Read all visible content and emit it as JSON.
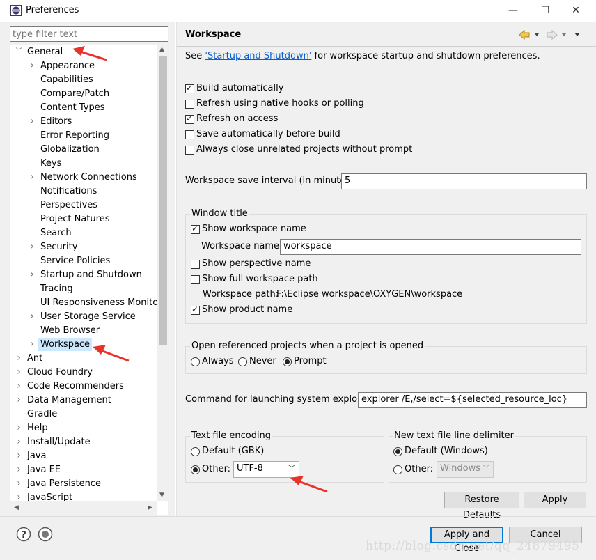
{
  "window": {
    "title": "Preferences",
    "minimize_glyph": "—",
    "maximize_glyph": "☐",
    "close_glyph": "✕"
  },
  "filter": {
    "placeholder": "type filter text"
  },
  "tree": {
    "general": "General",
    "general_children": [
      {
        "label": "Appearance",
        "expandable": true
      },
      {
        "label": "Capabilities",
        "expandable": false
      },
      {
        "label": "Compare/Patch",
        "expandable": false
      },
      {
        "label": "Content Types",
        "expandable": false
      },
      {
        "label": "Editors",
        "expandable": true
      },
      {
        "label": "Error Reporting",
        "expandable": false
      },
      {
        "label": "Globalization",
        "expandable": false
      },
      {
        "label": "Keys",
        "expandable": false
      },
      {
        "label": "Network Connections",
        "expandable": true
      },
      {
        "label": "Notifications",
        "expandable": false
      },
      {
        "label": "Perspectives",
        "expandable": false
      },
      {
        "label": "Project Natures",
        "expandable": false
      },
      {
        "label": "Search",
        "expandable": false
      },
      {
        "label": "Security",
        "expandable": true
      },
      {
        "label": "Service Policies",
        "expandable": false
      },
      {
        "label": "Startup and Shutdown",
        "expandable": true
      },
      {
        "label": "Tracing",
        "expandable": false
      },
      {
        "label": "UI Responsiveness Monitoring",
        "expandable": false
      },
      {
        "label": "User Storage Service",
        "expandable": true
      },
      {
        "label": "Web Browser",
        "expandable": false
      },
      {
        "label": "Workspace",
        "expandable": true,
        "selected": true
      }
    ],
    "top_level": [
      {
        "label": "Ant",
        "expandable": true
      },
      {
        "label": "Cloud Foundry",
        "expandable": true
      },
      {
        "label": "Code Recommenders",
        "expandable": true
      },
      {
        "label": "Data Management",
        "expandable": true
      },
      {
        "label": "Gradle",
        "expandable": false
      },
      {
        "label": "Help",
        "expandable": true
      },
      {
        "label": "Install/Update",
        "expandable": true
      },
      {
        "label": "Java",
        "expandable": true
      },
      {
        "label": "Java EE",
        "expandable": true
      },
      {
        "label": "Java Persistence",
        "expandable": true
      },
      {
        "label": "JavaScript",
        "expandable": true
      }
    ]
  },
  "panel": {
    "title": "Workspace",
    "see_prefix": "See ",
    "see_link": "'Startup and Shutdown'",
    "see_suffix": " for workspace startup and shutdown preferences.",
    "options": [
      {
        "label": "Build automatically",
        "checked": true
      },
      {
        "label": "Refresh using native hooks or polling",
        "checked": false
      },
      {
        "label": "Refresh on access",
        "checked": true
      },
      {
        "label": "Save automatically before build",
        "checked": false
      },
      {
        "label": "Always close unrelated projects without prompt",
        "checked": false
      }
    ],
    "save_interval_label": "Workspace save interval (in minutes):",
    "save_interval_value": "5",
    "window_title": {
      "legend": "Window title",
      "show_workspace_name": {
        "label": "Show workspace name",
        "checked": true
      },
      "workspace_name_label": "Workspace name:",
      "workspace_name_value": "workspace",
      "show_perspective_name": {
        "label": "Show perspective name",
        "checked": false
      },
      "show_full_path": {
        "label": "Show full workspace path",
        "checked": false
      },
      "workspace_path_label": "Workspace path:",
      "workspace_path_value": "F:\\Eclipse workspace\\OXYGEN\\workspace",
      "show_product_name": {
        "label": "Show product name",
        "checked": true
      }
    },
    "open_referenced": {
      "legend": "Open referenced projects when a project is opened",
      "choices": [
        {
          "label": "Always",
          "selected": false
        },
        {
          "label": "Never",
          "selected": false
        },
        {
          "label": "Prompt",
          "selected": true
        }
      ]
    },
    "explorer_label": "Command for launching system explorer:",
    "explorer_value": "explorer /E,/select=${selected_resource_loc}",
    "encoding": {
      "legend": "Text file encoding",
      "default_label": "Default (GBK)",
      "other_label": "Other:",
      "other_selected": true,
      "other_value": "UTF-8"
    },
    "delimiter": {
      "legend": "New text file line delimiter",
      "default_label": "Default (Windows)",
      "other_label": "Other:",
      "default_selected": true,
      "other_value": "Windows"
    },
    "restore_defaults": "Restore Defaults",
    "apply": "Apply"
  },
  "footer": {
    "apply_and_close": "Apply and Close",
    "cancel": "Cancel",
    "help_glyph": "?",
    "watermark": "http://blog.csdn.net/qq_24879495"
  },
  "colors": {
    "selection": "#cce8ff",
    "link": "#0a5fcf",
    "annotation_arrow": "#e8332a",
    "default_button_border": "#0078d7"
  }
}
